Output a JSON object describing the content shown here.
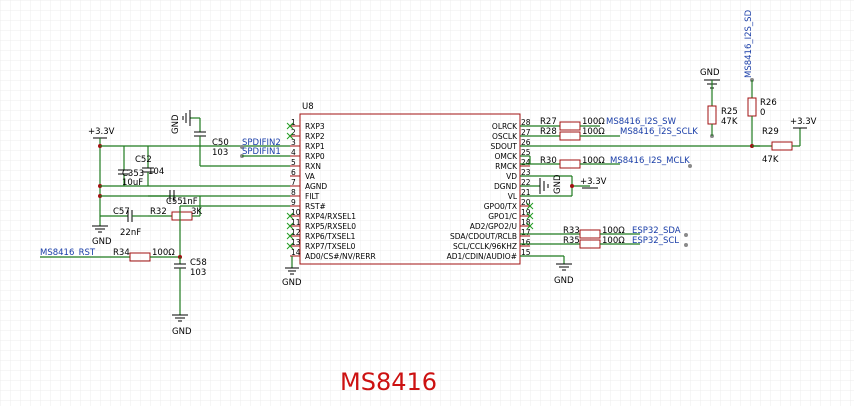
{
  "title": "MS8416",
  "chip": {
    "ref": "U8",
    "left_pins": [
      {
        "num": "1",
        "name": "RXP3"
      },
      {
        "num": "2",
        "name": "RXP2"
      },
      {
        "num": "3",
        "name": "RXP1"
      },
      {
        "num": "4",
        "name": "RXP0"
      },
      {
        "num": "5",
        "name": "RXN"
      },
      {
        "num": "6",
        "name": "VA"
      },
      {
        "num": "7",
        "name": "AGND"
      },
      {
        "num": "8",
        "name": "FILT"
      },
      {
        "num": "9",
        "name": "RST#"
      },
      {
        "num": "10",
        "name": "RXP4/RXSEL1"
      },
      {
        "num": "11",
        "name": "RXP5/RXSEL0"
      },
      {
        "num": "12",
        "name": "RXP6/TXSEL1"
      },
      {
        "num": "13",
        "name": "RXP7/TXSEL0"
      },
      {
        "num": "14",
        "name": "AD0/CS#/NV/RERR"
      }
    ],
    "right_pins": [
      {
        "num": "28",
        "name": "OLRCK"
      },
      {
        "num": "27",
        "name": "OSCLK"
      },
      {
        "num": "26",
        "name": "SDOUT"
      },
      {
        "num": "25",
        "name": "OMCK"
      },
      {
        "num": "24",
        "name": "RMCK"
      },
      {
        "num": "23",
        "name": "VD"
      },
      {
        "num": "22",
        "name": "DGND"
      },
      {
        "num": "21",
        "name": "VL"
      },
      {
        "num": "20",
        "name": "GPO0/TX"
      },
      {
        "num": "19",
        "name": "GPO1/C"
      },
      {
        "num": "18",
        "name": "AD2/GPO2/U"
      },
      {
        "num": "17",
        "name": "SDA/CDOUT/RCLB"
      },
      {
        "num": "16",
        "name": "SCL/CCLK/96KHZ"
      },
      {
        "num": "15",
        "name": "AD1/CDIN/AUDIO#"
      }
    ]
  },
  "components": {
    "c50": {
      "ref": "C50",
      "value": "103"
    },
    "c52": {
      "ref": "C52",
      "value": "104"
    },
    "c353": {
      "ref": "C353",
      "value": "10uF"
    },
    "c55": {
      "ref": "C55",
      "value": "1nF"
    },
    "c57": {
      "ref": "C57",
      "value": "22nF"
    },
    "c58": {
      "ref": "C58",
      "value": "103"
    },
    "r32": {
      "ref": "R32",
      "value": "3K"
    },
    "r34": {
      "ref": "R34",
      "value": "100Ω"
    },
    "r27": {
      "ref": "R27",
      "value": "100Ω"
    },
    "r28": {
      "ref": "R28",
      "value": "100Ω"
    },
    "r30": {
      "ref": "R30",
      "value": "100Ω"
    },
    "r33": {
      "ref": "R33",
      "value": "100Ω"
    },
    "r35": {
      "ref": "R35",
      "value": "100Ω"
    },
    "r25": {
      "ref": "R25",
      "value": "47K"
    },
    "r26": {
      "ref": "R26",
      "value": "0"
    },
    "r29": {
      "ref": "R29",
      "value": "47K"
    }
  },
  "power": {
    "v33": "+3.3V",
    "gnd": "GND"
  },
  "nets": {
    "spdifin2": "SPDIFIN2",
    "spdifin1": "SPDIFIN1",
    "rst": "MS8416_RST",
    "i2s_sw": "MS8416_I2S_SW",
    "i2s_sclk": "MS8416_I2S_SCLK",
    "i2s_mclk": "MS8416_I2S_MCLK",
    "i2s_sd": "MS8416_I2S_SD",
    "esp_sda": "ESP32_SDA",
    "esp_scl": "ESP32_SCL"
  }
}
